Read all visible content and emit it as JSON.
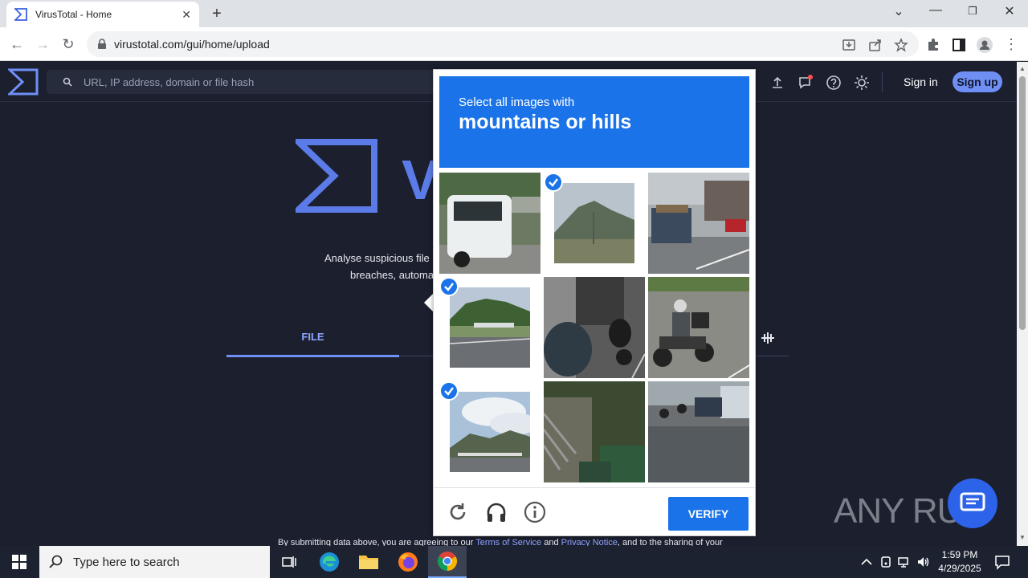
{
  "browser": {
    "tab_title": "VirusTotal - Home",
    "url": "virustotal.com/gui/home/upload"
  },
  "vt": {
    "search_placeholder": "URL, IP address, domain or file hash",
    "sign_in": "Sign in",
    "sign_up": "Sign up",
    "logo_partial": "V",
    "desc_line1": "Analyse suspicious file",
    "desc_line2": "breaches, automa",
    "tab_file": "FILE",
    "footer_prefix": "By submitting data above, you are agreeing to our ",
    "footer_tos": "Terms of Service",
    "footer_and": " and ",
    "footer_privacy": "Privacy Notice",
    "footer_suffix": ", and to the sharing of your"
  },
  "captcha": {
    "prompt_line1": "Select all images with",
    "prompt_line2": "mountains or hills",
    "verify_label": "VERIFY",
    "tiles": [
      {
        "subject": "white van",
        "selected": false
      },
      {
        "subject": "mountain landscape",
        "selected": true
      },
      {
        "subject": "truck on street",
        "selected": false
      },
      {
        "subject": "hills with bridge",
        "selected": true
      },
      {
        "subject": "parked motorcycles",
        "selected": false
      },
      {
        "subject": "motorcycle rider",
        "selected": false
      },
      {
        "subject": "sky with hills",
        "selected": true
      },
      {
        "subject": "stairs and bins",
        "selected": false
      },
      {
        "subject": "wet street traffic",
        "selected": false
      }
    ]
  },
  "watermark": "ANY RUN",
  "taskbar": {
    "search_placeholder": "Type here to search",
    "time": "1:59 PM",
    "date": "4/29/2025"
  },
  "colors": {
    "vt_bg": "#1b1f2e",
    "vt_accent": "#6f8ff5",
    "captcha_blue": "#1a73e8"
  }
}
